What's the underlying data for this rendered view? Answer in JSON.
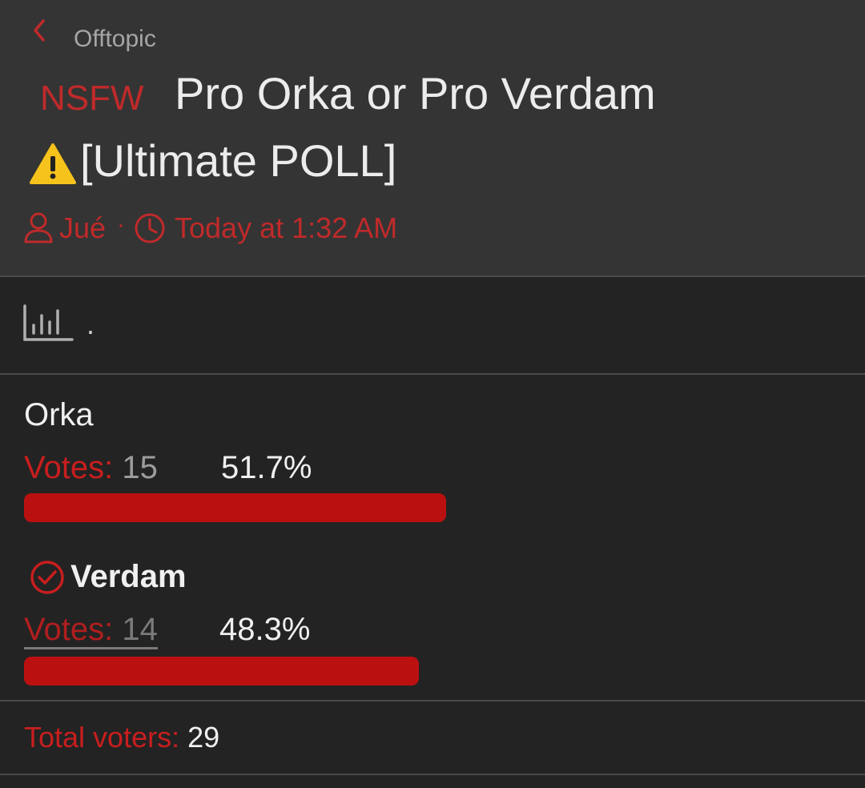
{
  "header": {
    "back_label": "Offtopic",
    "prefix": "NSFW",
    "title_line1": "Pro Orka or Pro Verdam",
    "title_line2": "[Ultimate POLL]",
    "author": "Jué",
    "separator": "·",
    "timestamp": "Today at 1:32 AM"
  },
  "poll": {
    "question": ".",
    "votes_label": "Votes:",
    "options": [
      {
        "label": "Orka",
        "votes": "15",
        "percent": "51.7%",
        "fraction": 0.517,
        "voted": false
      },
      {
        "label": "Verdam",
        "votes": "14",
        "percent": "48.3%",
        "fraction": 0.483,
        "voted": true
      }
    ],
    "total_label": "Total voters:",
    "total_value": "29"
  },
  "colors": {
    "accent": "#c02a2a",
    "bar": "#bb1010",
    "header_bg": "#343434",
    "body_bg": "#232323"
  },
  "icons": [
    "chevron-left-icon",
    "warning-icon",
    "user-icon",
    "clock-icon",
    "poll-chart-icon",
    "check-circle-icon"
  ]
}
